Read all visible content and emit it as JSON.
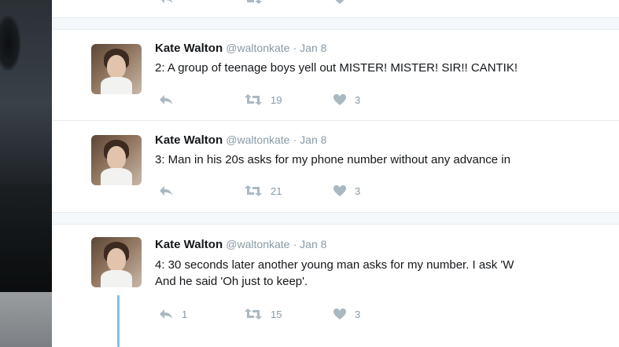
{
  "colors": {
    "name": "#14171a",
    "meta": "#8899a6",
    "divider": "#e6ecf0",
    "thread_line": "#7cc3e3"
  },
  "tweets": [
    {
      "name": "Kate Walton",
      "handle": "@waltonkate",
      "date": "· Jan 8",
      "text": "2: A group of teenage boys yell out MISTER! MISTER! SIR!! CANTIK!",
      "reply_count": "",
      "retweet_count": "19",
      "like_count": "3"
    },
    {
      "name": "Kate Walton",
      "handle": "@waltonkate",
      "date": "· Jan 8",
      "text": "3: Man in his 20s asks for my phone number without any advance in",
      "reply_count": "",
      "retweet_count": "21",
      "like_count": "3"
    },
    {
      "name": "Kate Walton",
      "handle": "@waltonkate",
      "date": "· Jan 8",
      "text": "4: 30 seconds later another young man asks for my number. I ask 'W",
      "text2": "And he said 'Oh just to keep'.",
      "reply_count": "1",
      "retweet_count": "15",
      "like_count": "3"
    }
  ],
  "icons": {
    "reply": "reply-icon",
    "retweet": "retweet-icon",
    "like": "heart-icon"
  }
}
